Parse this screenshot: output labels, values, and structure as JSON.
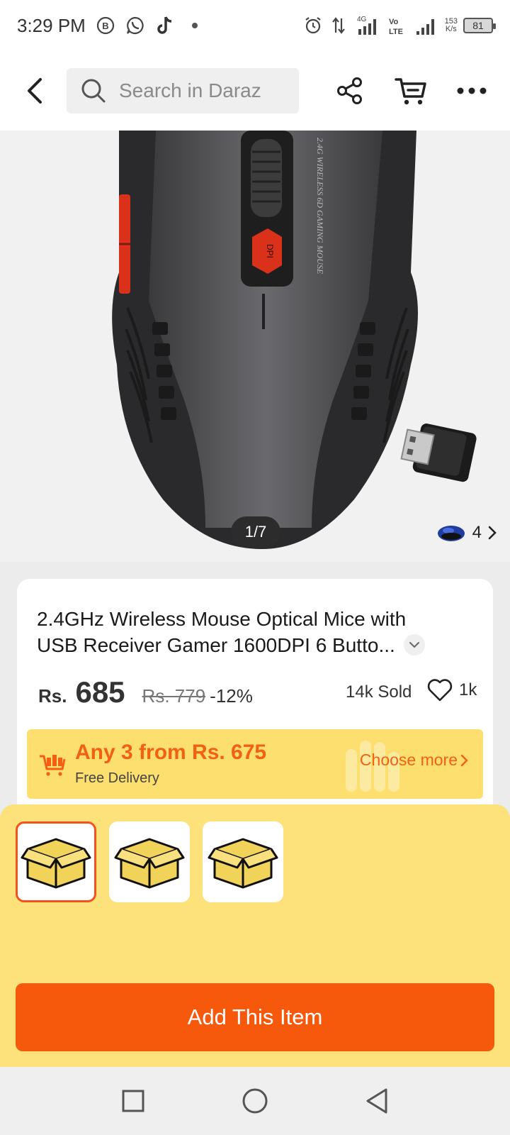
{
  "status_bar": {
    "time": "3:29 PM",
    "network_rate": "153",
    "network_unit": "K/s",
    "battery": "81",
    "signal_labels": [
      "4G",
      "Vo LTE"
    ]
  },
  "top_nav": {
    "search_placeholder": "Search in Daraz"
  },
  "gallery": {
    "counter": "1/7",
    "variant_count": "4"
  },
  "product": {
    "title": "2.4GHz Wireless Mouse Optical Mice with USB Receiver Gamer 1600DPI 6 Butto...",
    "currency": "Rs.",
    "price": "685",
    "original_price": "Rs. 779",
    "discount": "-12%",
    "sold": "14k Sold",
    "wishlist_count": "1k",
    "image_text": "2.4G WIRELESS 6D GAMING MOUSE",
    "button_label": "DPI"
  },
  "promo": {
    "title": "Any 3 from Rs. 675",
    "subtitle": "Free Delivery",
    "action": "Choose more"
  },
  "sheet": {
    "thumbnails": [
      "box",
      "box",
      "box"
    ],
    "selected_index": 0,
    "add_button": "Add This Item"
  },
  "colors": {
    "accent": "#f6580c",
    "promo_bg": "#fddf6f",
    "sheet_bg": "#fde17a"
  }
}
